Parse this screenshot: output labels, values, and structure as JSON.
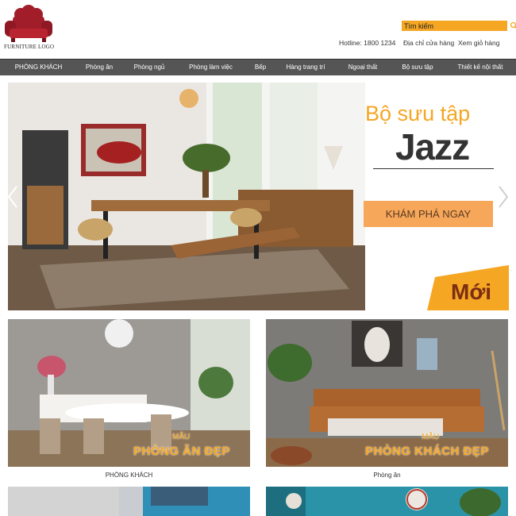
{
  "header": {
    "logo_text": "FURNITURE LOGO",
    "search_placeholder": "Tìm kiếm",
    "hotline": "Hotline: 1800 1234",
    "store_link": "Địa chỉ cửa hàng",
    "cart_link": "Xem giỏ hàng"
  },
  "nav": {
    "items": [
      {
        "label": "PHÒNG KHÁCH"
      },
      {
        "label": "Phòng ăn"
      },
      {
        "label": "Phòng ngủ"
      },
      {
        "label": "Phòng làm việc"
      },
      {
        "label": "Bếp"
      },
      {
        "label": "Hàng trang trí"
      },
      {
        "label": "Ngoại thất"
      },
      {
        "label": "Bộ sưu tập"
      },
      {
        "label": "Thiết kế nội thất"
      }
    ]
  },
  "hero": {
    "subtitle": "Bộ sưu tập",
    "title": "Jazz",
    "cta": "KHÁM PHÁ NGAY",
    "badge": "Mới"
  },
  "cards": [
    {
      "overlay_small": "MẪU",
      "overlay_big": "PHÒNG ĂN ĐẸP",
      "caption": "PHÒNG KHÁCH"
    },
    {
      "overlay_small": "MẪU",
      "overlay_big": "PHÒNG KHÁCH ĐẸP",
      "caption": "Phòng ăn"
    }
  ],
  "colors": {
    "accent": "#f5a623",
    "nav_bg": "#555555",
    "cta_bg": "#f7a75a",
    "logo_red": "#a11d2a"
  }
}
